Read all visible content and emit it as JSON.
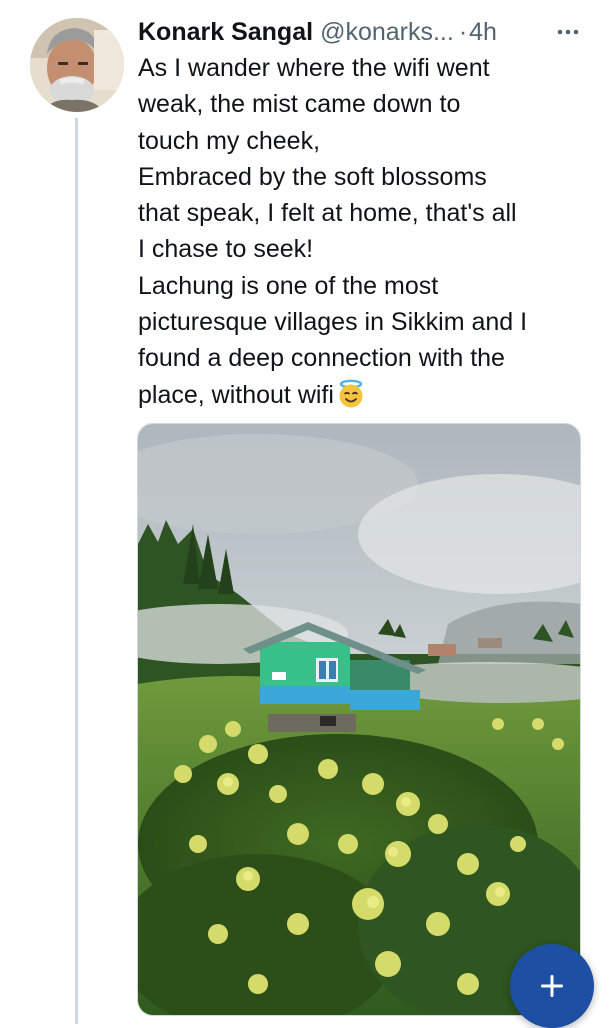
{
  "tweet": {
    "author_name": "Konark Sangal",
    "author_handle": "@konarks...",
    "separator": "·",
    "timestamp": "4h",
    "more_icon": "more-dots-icon",
    "body_lines": [
      "As I wander where the wifi went",
      "weak, the mist came down to",
      "touch my cheek,",
      "Embraced by the soft blossoms",
      "that speak, I felt at home, that's all",
      "I chase to seek!",
      "Lachung is one of the most",
      "picturesque villages in Sikkim and I",
      "found a deep connection with the",
      "place, without wifi"
    ],
    "trailing_emoji": "smiling-face-with-halo-emoji"
  },
  "compose_button": {
    "icon": "plus-icon",
    "color": "#1d4fa3"
  },
  "colors": {
    "text": "#0f1419",
    "secondary_text": "#536471",
    "thread_line": "#cfd9de"
  }
}
